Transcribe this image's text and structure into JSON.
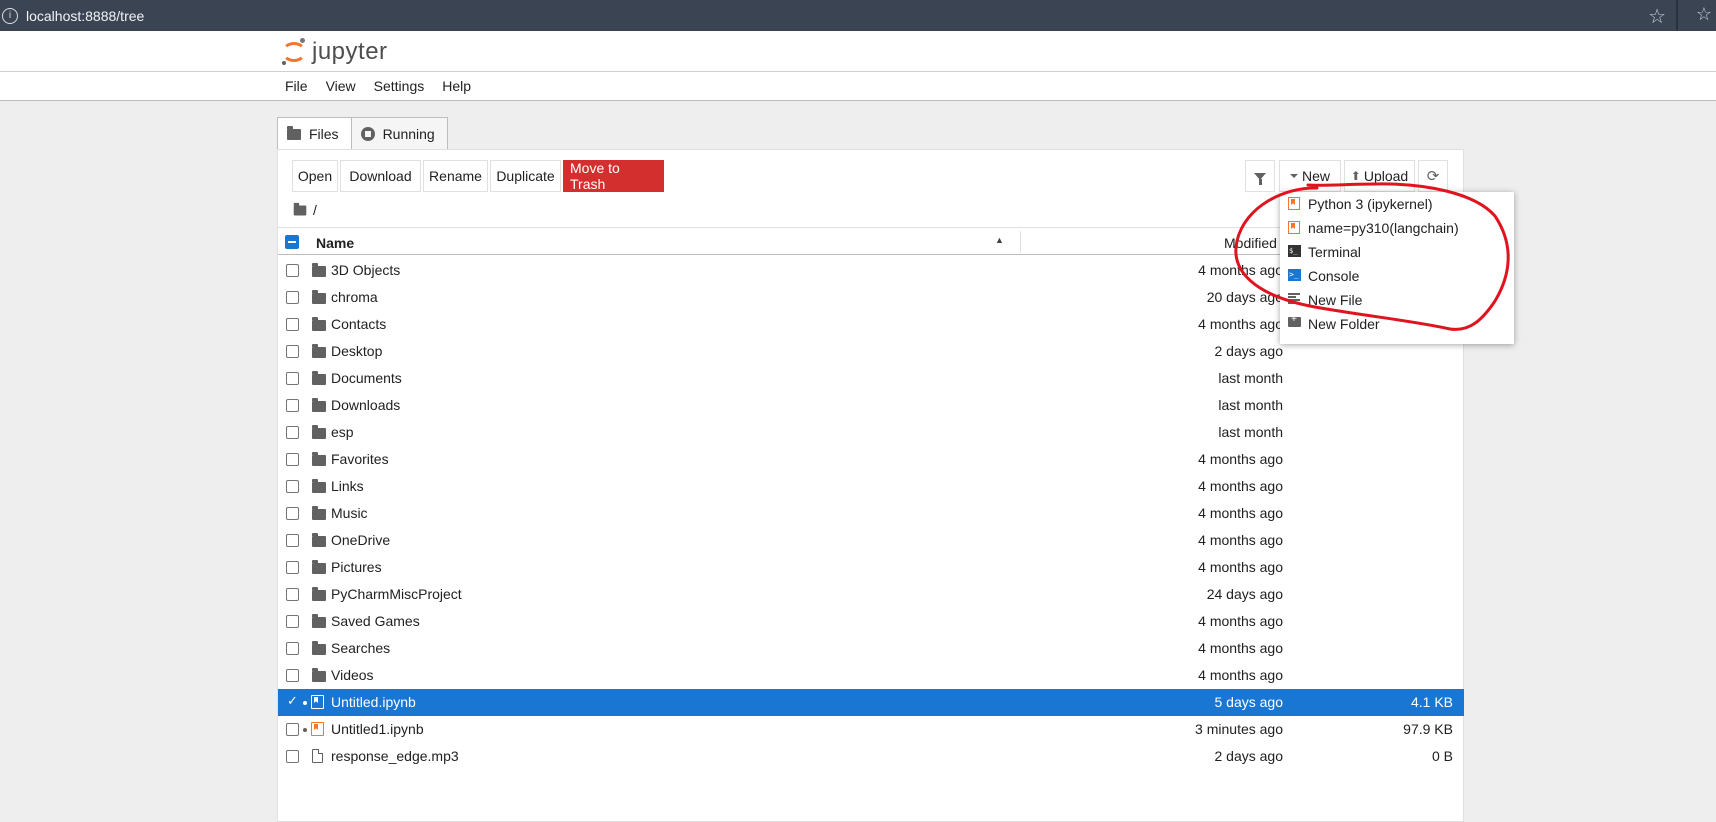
{
  "browser": {
    "url": "localhost:8888/tree"
  },
  "header": {
    "logo_text": "jupyter",
    "menu": [
      "File",
      "View",
      "Settings",
      "Help"
    ]
  },
  "tabs": [
    {
      "label": "Files",
      "icon": "folder-icon",
      "active": true
    },
    {
      "label": "Running",
      "icon": "stop-circle-icon",
      "active": false
    }
  ],
  "toolbar": {
    "open": "Open",
    "download": "Download",
    "rename": "Rename",
    "duplicate": "Duplicate",
    "trash": "Move to Trash",
    "new": "New",
    "upload": "Upload"
  },
  "breadcrumb": "/",
  "table": {
    "headers": {
      "name": "Name",
      "modified": "Modified"
    },
    "rows": [
      {
        "name": "3D Objects",
        "modified": "4 months ago",
        "size": "",
        "type": "folder"
      },
      {
        "name": "chroma",
        "modified": "20 days ago",
        "size": "",
        "type": "folder"
      },
      {
        "name": "Contacts",
        "modified": "4 months ago",
        "size": "",
        "type": "folder"
      },
      {
        "name": "Desktop",
        "modified": "2 days ago",
        "size": "",
        "type": "folder"
      },
      {
        "name": "Documents",
        "modified": "last month",
        "size": "",
        "type": "folder"
      },
      {
        "name": "Downloads",
        "modified": "last month",
        "size": "",
        "type": "folder"
      },
      {
        "name": "esp",
        "modified": "last month",
        "size": "",
        "type": "folder"
      },
      {
        "name": "Favorites",
        "modified": "4 months ago",
        "size": "",
        "type": "folder"
      },
      {
        "name": "Links",
        "modified": "4 months ago",
        "size": "",
        "type": "folder"
      },
      {
        "name": "Music",
        "modified": "4 months ago",
        "size": "",
        "type": "folder"
      },
      {
        "name": "OneDrive",
        "modified": "4 months ago",
        "size": "",
        "type": "folder"
      },
      {
        "name": "Pictures",
        "modified": "4 months ago",
        "size": "",
        "type": "folder"
      },
      {
        "name": "PyCharmMiscProject",
        "modified": "24 days ago",
        "size": "",
        "type": "folder"
      },
      {
        "name": "Saved Games",
        "modified": "4 months ago",
        "size": "",
        "type": "folder"
      },
      {
        "name": "Searches",
        "modified": "4 months ago",
        "size": "",
        "type": "folder"
      },
      {
        "name": "Videos",
        "modified": "4 months ago",
        "size": "",
        "type": "folder"
      },
      {
        "name": "Untitled.ipynb",
        "modified": "5 days ago",
        "size": "4.1 KB",
        "type": "notebook"
      },
      {
        "name": "Untitled1.ipynb",
        "modified": "3 minutes ago",
        "size": "97.9 KB",
        "type": "notebook"
      },
      {
        "name": "response_edge.mp3",
        "modified": "2 days ago",
        "size": "0 B",
        "type": "file"
      }
    ]
  },
  "new_menu": [
    {
      "label": "Python 3 (ipykernel)",
      "icon": "notebook-icon"
    },
    {
      "label": "name=py310(langchain)",
      "icon": "notebook-icon"
    },
    {
      "label": "Terminal",
      "icon": "terminal-icon"
    },
    {
      "label": "Console",
      "icon": "console-icon"
    },
    {
      "label": "New File",
      "icon": "text-file-icon"
    },
    {
      "label": "New Folder",
      "icon": "new-folder-icon"
    }
  ],
  "colors": {
    "accent": "#1976d2",
    "danger": "#d32f2f",
    "notebook": "#f37726",
    "annotation": "#e0141e"
  }
}
